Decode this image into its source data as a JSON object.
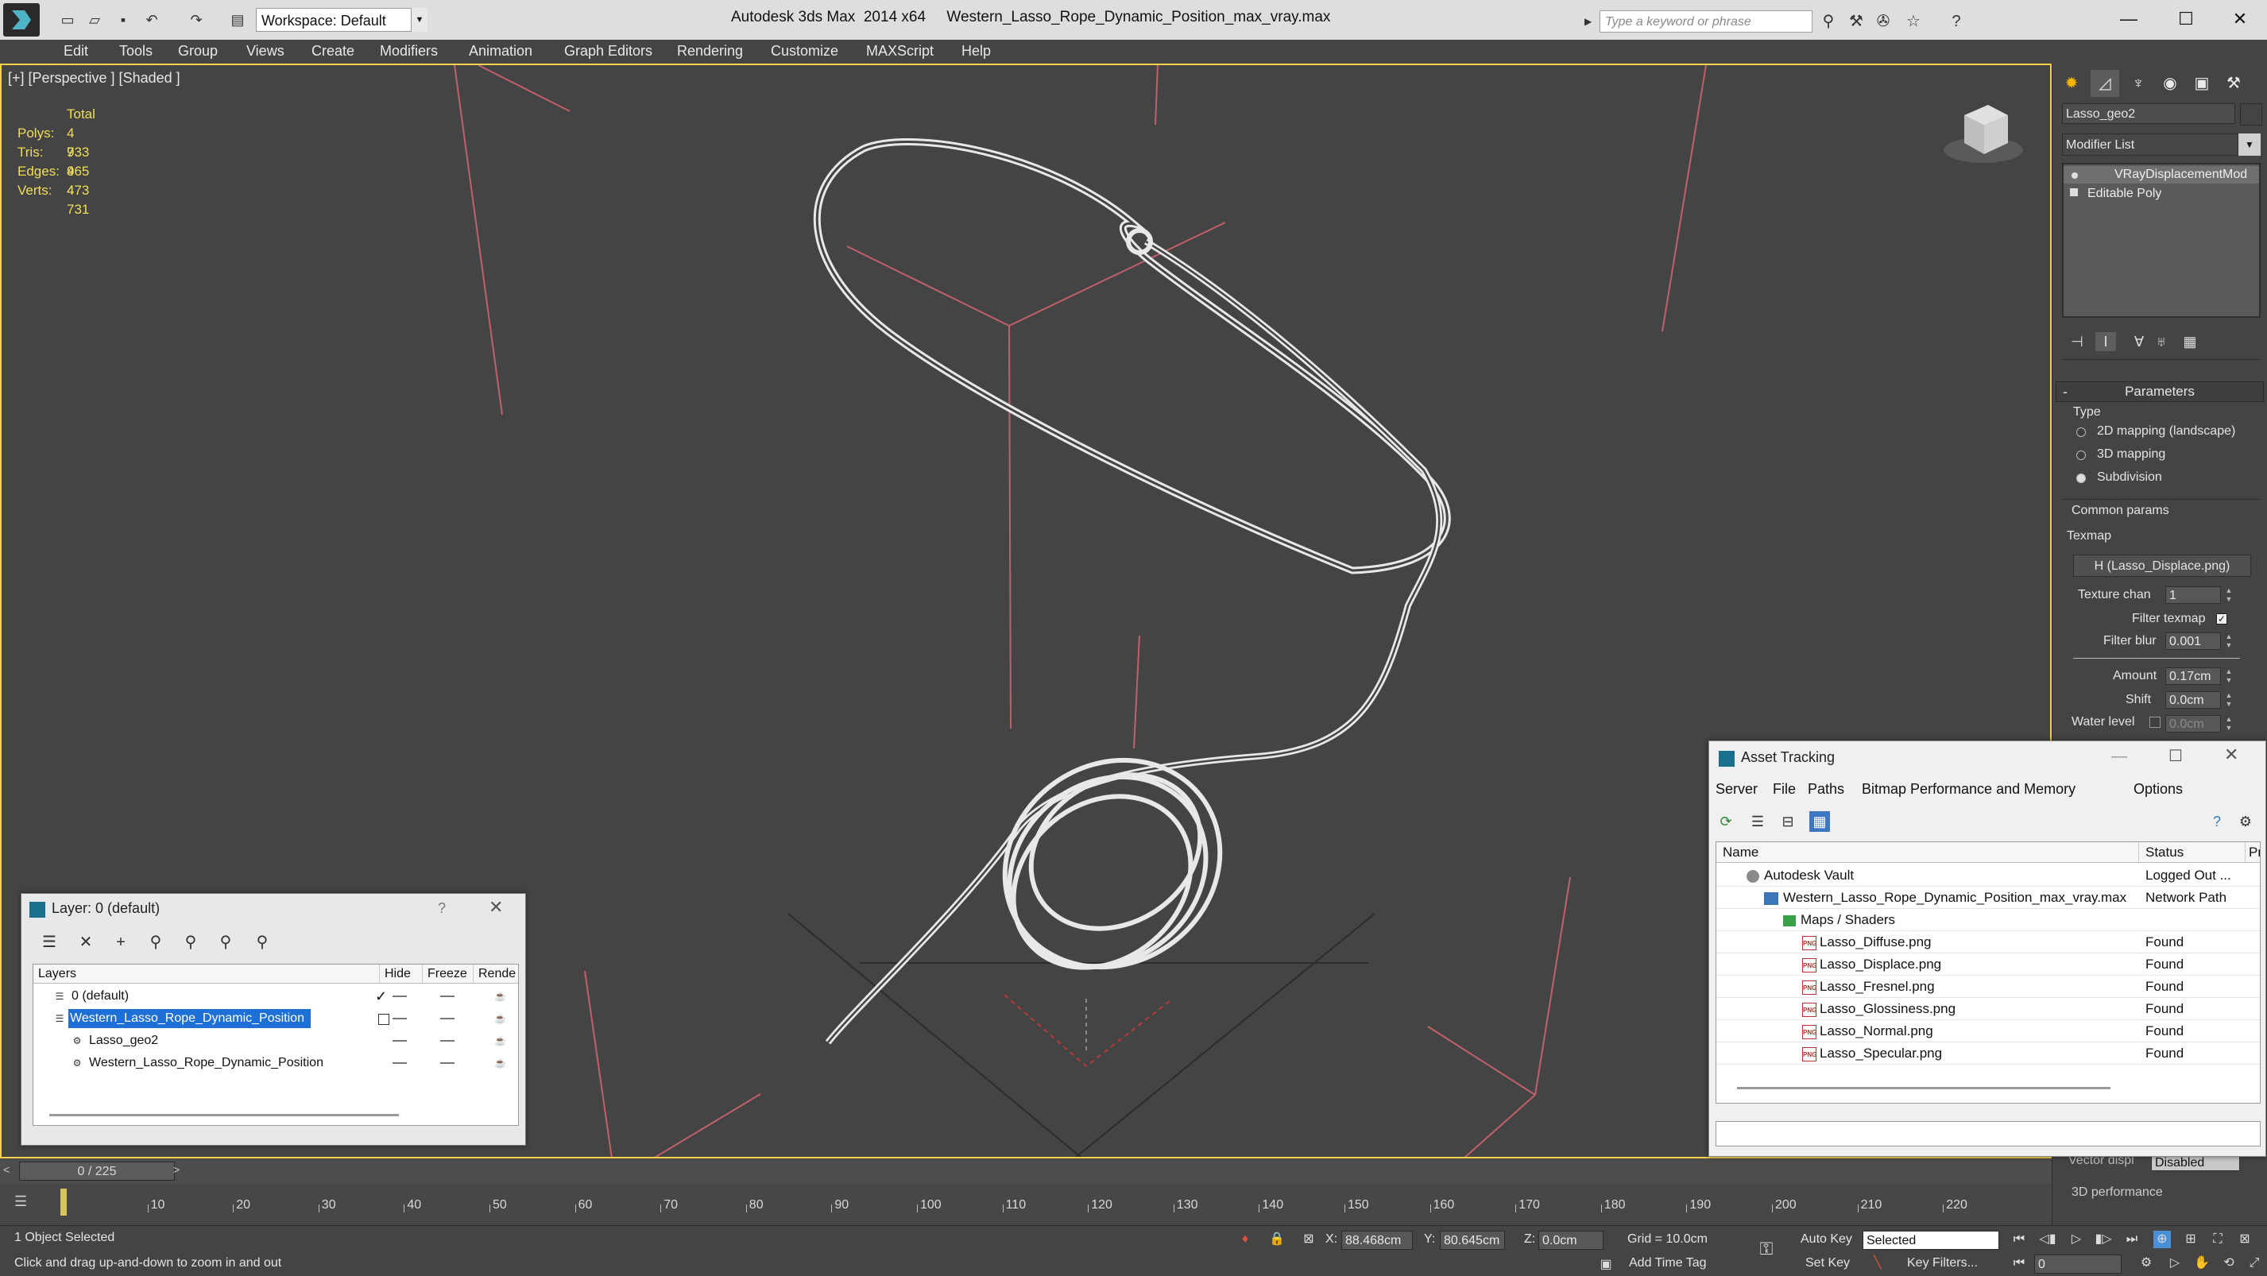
{
  "titlebar": {
    "workspace": "Workspace: Default",
    "app_title": "Autodesk 3ds Max  2014 x64     Western_Lasso_Rope_Dynamic_Position_max_vray.max",
    "search_placeholder": "Type a keyword or phrase"
  },
  "menu": [
    "Edit",
    "Tools",
    "Group",
    "Views",
    "Create",
    "Modifiers",
    "Animation",
    "Graph Editors",
    "Rendering",
    "Customize",
    "MAXScript",
    "Help"
  ],
  "viewport": {
    "label": "[+] [Perspective ] [Shaded ]",
    "stats": {
      "total_label": "Total",
      "rows": [
        {
          "label": "Polys:",
          "value": "4 733"
        },
        {
          "label": "Tris:",
          "value": "9 465"
        },
        {
          "label": "Edges:",
          "value": "9 473"
        },
        {
          "label": "Verts:",
          "value": "4 731"
        }
      ]
    },
    "colors": {
      "grid_red": "#c0606a",
      "wire": "#e6e6e6",
      "border_active": "#f3d24b"
    }
  },
  "command_panel": {
    "object_name": "Lasso_geo2",
    "modifier_list": "Modifier List",
    "stack": [
      "VRayDisplacementMod",
      "Editable Poly"
    ],
    "parameters": {
      "title": "Parameters",
      "type_label": "Type",
      "types": [
        "2D mapping (landscape)",
        "3D mapping",
        "Subdivision"
      ],
      "selected_type": "Subdivision",
      "common_params_label": "Common params",
      "texmap_label": "Texmap",
      "texmap_button": "H (Lasso_Displace.png)",
      "texture_chan_label": "Texture chan",
      "texture_chan": "1",
      "filter_texmap_label": "Filter texmap",
      "filter_blur_label": "Filter blur",
      "filter_blur": "0.001",
      "amount_label": "Amount",
      "amount": "0.17cm",
      "shift_label": "Shift",
      "shift": "0.0cm",
      "water_level_label": "Water level",
      "water_level": "0.0cm",
      "vector_disp_label": "Vector displ",
      "vector_disp": "Disabled",
      "perf_label": "3D performance"
    }
  },
  "layer_dialog": {
    "title": "Layer: 0 (default)",
    "help": "?",
    "columns": [
      "Layers",
      "Hide",
      "Freeze",
      "Rende"
    ],
    "rows": [
      {
        "name": "0 (default)",
        "check": "✓"
      },
      {
        "name": "Western_Lasso_Rope_Dynamic_Position",
        "selected": true
      },
      {
        "name": "Lasso_geo2"
      },
      {
        "name": "Western_Lasso_Rope_Dynamic_Position"
      }
    ]
  },
  "asset_dialog": {
    "title": "Asset Tracking",
    "menu": [
      "Server",
      "File",
      "Paths",
      "Bitmap Performance and Memory",
      "Options"
    ],
    "columns": [
      "Name",
      "Status",
      "Pr"
    ],
    "rows": [
      {
        "name": "Autodesk Vault",
        "status": "Logged Out ...",
        "kind": "vault"
      },
      {
        "name": "Western_Lasso_Rope_Dynamic_Position_max_vray.max",
        "status": "Network Path",
        "kind": "file"
      },
      {
        "name": "Maps / Shaders",
        "status": "",
        "kind": "folder"
      },
      {
        "name": "Lasso_Diffuse.png",
        "status": "Found",
        "kind": "png"
      },
      {
        "name": "Lasso_Displace.png",
        "status": "Found",
        "kind": "png"
      },
      {
        "name": "Lasso_Fresnel.png",
        "status": "Found",
        "kind": "png"
      },
      {
        "name": "Lasso_Glossiness.png",
        "status": "Found",
        "kind": "png"
      },
      {
        "name": "Lasso_Normal.png",
        "status": "Found",
        "kind": "png"
      },
      {
        "name": "Lasso_Specular.png",
        "status": "Found",
        "kind": "png"
      }
    ]
  },
  "timeline": {
    "slider": "0 / 225",
    "ticks": [
      "10",
      "20",
      "30",
      "40",
      "50",
      "60",
      "70",
      "80",
      "90",
      "100",
      "110",
      "120",
      "130",
      "140",
      "150",
      "160",
      "170",
      "180",
      "190",
      "200",
      "210",
      "220"
    ]
  },
  "status": {
    "selection": "1 Object Selected",
    "prompt": "Click and drag up-and-down to zoom in and out",
    "x_label": "X:",
    "x": "88.468cm",
    "y_label": "Y:",
    "y": "80.645cm",
    "z_label": "Z:",
    "z": "0.0cm",
    "grid": "Grid = 10.0cm",
    "add_time_tag": "Add Time Tag",
    "auto_key": "Auto Key",
    "set_key": "Set Key",
    "selected_dropdown": "Selected",
    "key_filters": "Key Filters...",
    "frame": "0"
  }
}
